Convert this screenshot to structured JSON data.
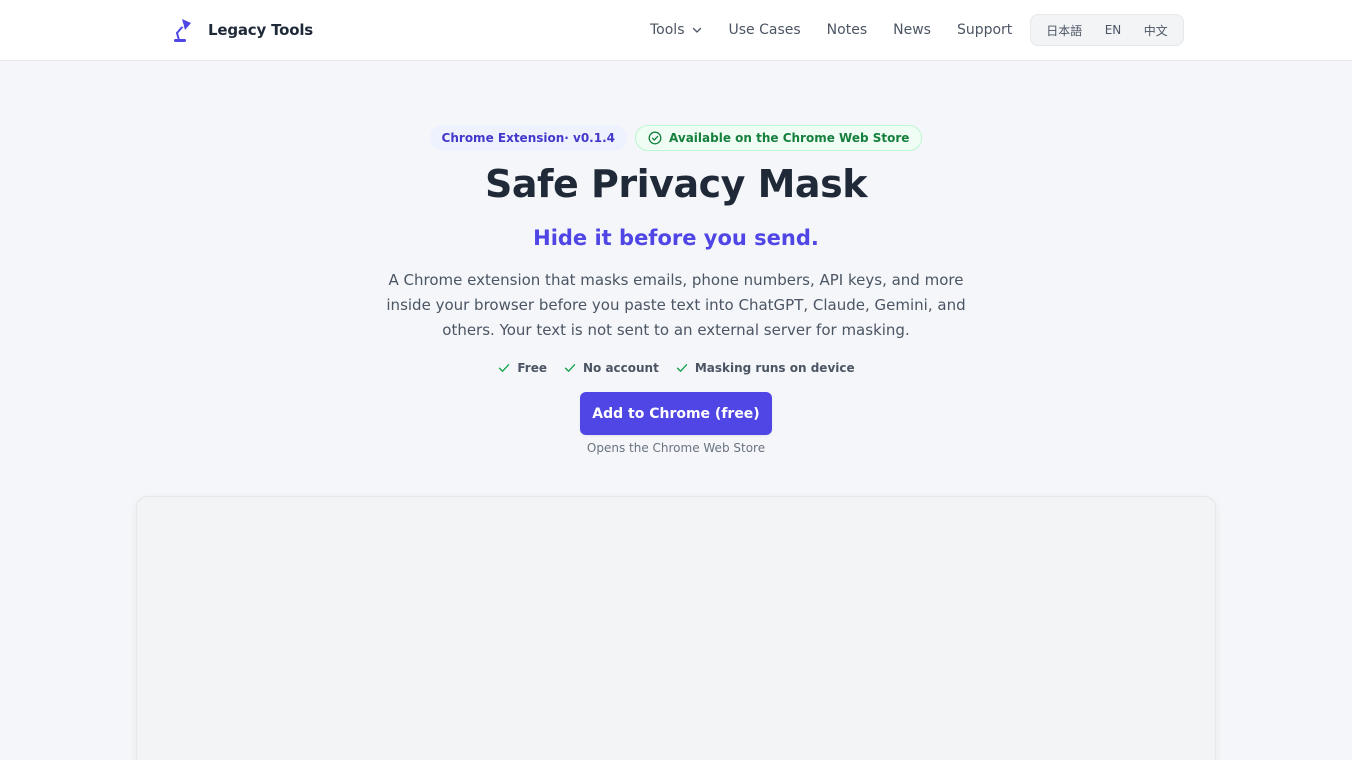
{
  "header": {
    "brand_name": "Legacy Tools",
    "brand_icon": "desk-lamp-icon",
    "nav": [
      {
        "label": "Tools",
        "has_dropdown": true
      },
      {
        "label": "Use Cases"
      },
      {
        "label": "Notes"
      },
      {
        "label": "News"
      },
      {
        "label": "Support"
      }
    ],
    "languages": [
      "日本語",
      "EN",
      "中文"
    ]
  },
  "hero": {
    "badge_version": "Chrome Extension· v0.1.4",
    "badge_store": "Available on the Chrome Web Store",
    "title": "Safe Privacy Mask",
    "tagline": "Hide it before you send.",
    "description": "A Chrome extension that masks emails, phone numbers, API keys, and more inside your browser before you paste text into ChatGPT, Claude, Gemini, and others. Your text is not sent to an external server for masking.",
    "features": [
      "Free",
      "No account",
      "Masking runs on device"
    ],
    "cta_label": "Add to Chrome (free)",
    "cta_note": "Opens the Chrome Web Store"
  },
  "colors": {
    "accent": "#4f46e5",
    "success": "#15803d",
    "background": "#f4f6f9"
  }
}
